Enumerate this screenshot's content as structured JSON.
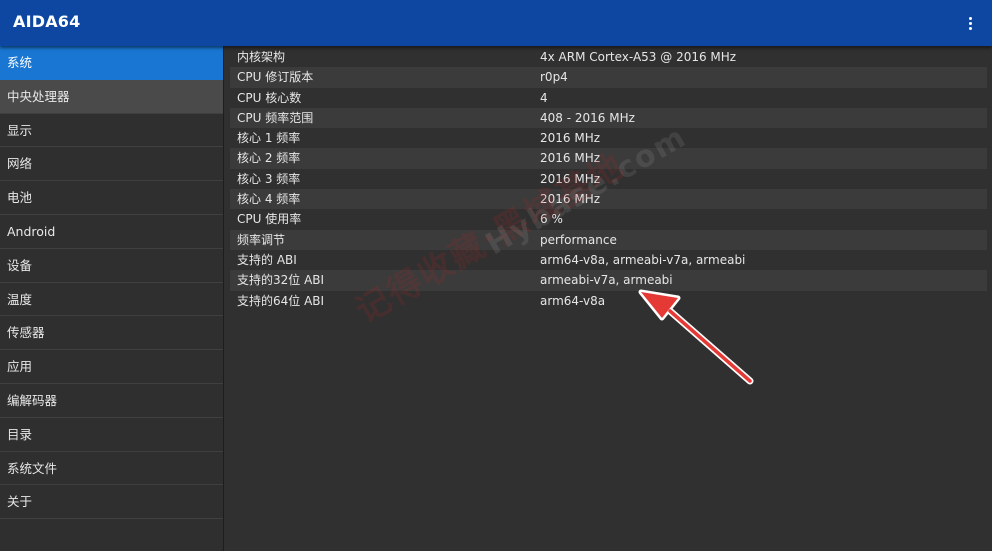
{
  "app": {
    "title": "AIDA64",
    "menu_icon": "more-vert-icon"
  },
  "sidebar": {
    "items": [
      {
        "label": "系统",
        "state": "active"
      },
      {
        "label": "中央处理器",
        "state": "selected"
      },
      {
        "label": "显示",
        "state": ""
      },
      {
        "label": "网络",
        "state": ""
      },
      {
        "label": "电池",
        "state": ""
      },
      {
        "label": "Android",
        "state": ""
      },
      {
        "label": "设备",
        "state": ""
      },
      {
        "label": "温度",
        "state": ""
      },
      {
        "label": "传感器",
        "state": ""
      },
      {
        "label": "应用",
        "state": ""
      },
      {
        "label": "编解码器",
        "state": ""
      },
      {
        "label": "目录",
        "state": ""
      },
      {
        "label": "系统文件",
        "state": ""
      },
      {
        "label": "关于",
        "state": ""
      }
    ]
  },
  "details": {
    "rows": [
      {
        "key": "内核架构",
        "value": "4x ARM Cortex-A53 @ 2016 MHz"
      },
      {
        "key": "CPU 修订版本",
        "value": "r0p4"
      },
      {
        "key": "CPU 核心数",
        "value": "4"
      },
      {
        "key": "CPU 频率范围",
        "value": "408 - 2016 MHz"
      },
      {
        "key": "核心 1 频率",
        "value": "2016 MHz"
      },
      {
        "key": "核心 2 频率",
        "value": "2016 MHz"
      },
      {
        "key": "核心 3 频率",
        "value": "2016 MHz"
      },
      {
        "key": "核心 4 频率",
        "value": "2016 MHz"
      },
      {
        "key": "CPU 使用率",
        "value": "6 %"
      },
      {
        "key": "频率调节",
        "value": "performance"
      },
      {
        "key": "支持的 ABI",
        "value": "arm64-v8a, armeabi-v7a, armeabi"
      },
      {
        "key": "支持的32位 ABI",
        "value": "armeabi-v7a, armeabi"
      },
      {
        "key": "支持的64位 ABI",
        "value": "arm64-v8a"
      }
    ]
  },
  "watermark": {
    "line1": "记得收藏·黑域基地",
    "line2": "Hybase.com"
  },
  "colors": {
    "appbar": "#0d47a1",
    "active": "#1976d2",
    "arrow": "#e53935"
  }
}
